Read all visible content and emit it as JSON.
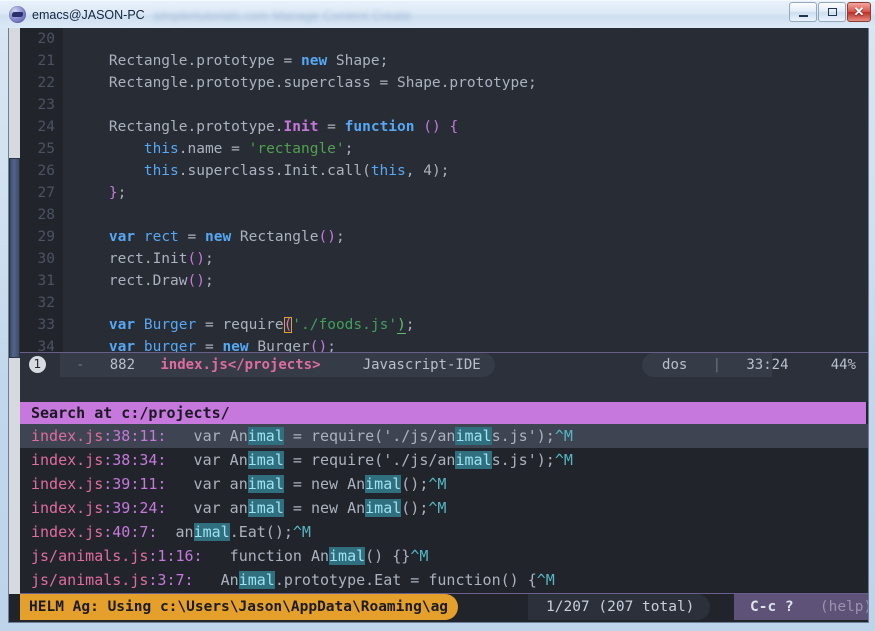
{
  "window": {
    "title": "emacs@JASON-PC",
    "ghost_title": "simplertutorials.com  Manage Content Create",
    "icon": "emacs-icon",
    "minimize_label": "–",
    "maximize_label": "□",
    "close_label": "✕"
  },
  "code": {
    "language": "Javascript",
    "lines": [
      {
        "n": "20",
        "segs": []
      },
      {
        "n": "21",
        "segs": [
          {
            "t": "    ",
            "c": "plain"
          },
          {
            "t": "Rectangle.prototype",
            "c": "plain"
          },
          {
            "t": " = ",
            "c": "plain"
          },
          {
            "t": "new",
            "c": "kw"
          },
          {
            "t": " Shape;",
            "c": "plain"
          }
        ]
      },
      {
        "n": "22",
        "segs": [
          {
            "t": "    ",
            "c": "plain"
          },
          {
            "t": "Rectangle.prototype.superclass",
            "c": "plain"
          },
          {
            "t": " = Shape.prototype;",
            "c": "plain"
          }
        ]
      },
      {
        "n": "23",
        "segs": []
      },
      {
        "n": "24",
        "segs": [
          {
            "t": "    ",
            "c": "plain"
          },
          {
            "t": "Rectangle.prototype.",
            "c": "plain"
          },
          {
            "t": "Init",
            "c": "fn"
          },
          {
            "t": " = ",
            "c": "plain"
          },
          {
            "t": "function",
            "c": "kw"
          },
          {
            "t": " ",
            "c": "plain"
          },
          {
            "t": "()",
            "c": "paren"
          },
          {
            "t": " ",
            "c": "plain"
          },
          {
            "t": "{",
            "c": "paren"
          }
        ]
      },
      {
        "n": "25",
        "segs": [
          {
            "t": "        ",
            "c": "plain"
          },
          {
            "t": "this",
            "c": "this"
          },
          {
            "t": ".name = ",
            "c": "plain"
          },
          {
            "t": "'rectangle'",
            "c": "str"
          },
          {
            "t": ";",
            "c": "plain"
          }
        ]
      },
      {
        "n": "26",
        "segs": [
          {
            "t": "        ",
            "c": "plain"
          },
          {
            "t": "this",
            "c": "this"
          },
          {
            "t": ".superclass.Init.call(",
            "c": "plain"
          },
          {
            "t": "this",
            "c": "this"
          },
          {
            "t": ", 4);",
            "c": "plain"
          }
        ]
      },
      {
        "n": "27",
        "segs": [
          {
            "t": "    ",
            "c": "plain"
          },
          {
            "t": "}",
            "c": "paren"
          },
          {
            "t": ";",
            "c": "plain"
          }
        ]
      },
      {
        "n": "28",
        "segs": []
      },
      {
        "n": "29",
        "segs": [
          {
            "t": "    ",
            "c": "plain"
          },
          {
            "t": "var",
            "c": "kw"
          },
          {
            "t": " ",
            "c": "plain"
          },
          {
            "t": "rect",
            "c": "var"
          },
          {
            "t": " = ",
            "c": "plain"
          },
          {
            "t": "new",
            "c": "kw"
          },
          {
            "t": " Rectangle",
            "c": "plain"
          },
          {
            "t": "()",
            "c": "paren"
          },
          {
            "t": ";",
            "c": "plain"
          }
        ]
      },
      {
        "n": "30",
        "segs": [
          {
            "t": "    ",
            "c": "plain"
          },
          {
            "t": "rect.Init",
            "c": "plain"
          },
          {
            "t": "()",
            "c": "paren"
          },
          {
            "t": ";",
            "c": "plain"
          }
        ]
      },
      {
        "n": "31",
        "segs": [
          {
            "t": "    ",
            "c": "plain"
          },
          {
            "t": "rect.Draw",
            "c": "plain"
          },
          {
            "t": "()",
            "c": "paren"
          },
          {
            "t": ";",
            "c": "plain"
          }
        ]
      },
      {
        "n": "32",
        "segs": []
      },
      {
        "n": "33",
        "segs": [
          {
            "t": "    ",
            "c": "plain"
          },
          {
            "t": "var",
            "c": "kw"
          },
          {
            "t": " ",
            "c": "plain"
          },
          {
            "t": "Burger",
            "c": "var"
          },
          {
            "t": " = require",
            "c": "plain"
          },
          {
            "t": "(",
            "c": "parenbox"
          },
          {
            "t": "'./foods.js'",
            "c": "strg"
          },
          {
            "t": ")",
            "c": "parenul"
          },
          {
            "t": ";",
            "c": "plain"
          }
        ]
      },
      {
        "n": "34",
        "segs": [
          {
            "t": "    ",
            "c": "plain"
          },
          {
            "t": "var",
            "c": "kw"
          },
          {
            "t": " ",
            "c": "plain"
          },
          {
            "t": "burger",
            "c": "var"
          },
          {
            "t": " = ",
            "c": "plain"
          },
          {
            "t": "new",
            "c": "kw"
          },
          {
            "t": " Burger",
            "c": "plain"
          },
          {
            "t": "()",
            "c": "paren"
          },
          {
            "t": ";",
            "c": "plain"
          }
        ]
      }
    ]
  },
  "modeline": {
    "window_number": "1",
    "modified": "-",
    "size": "882",
    "buffer": "index.js</projects>",
    "major_mode": "Javascript-IDE",
    "encoding": "dos",
    "separator": "|",
    "position": "33:24",
    "percent": "44%"
  },
  "helm": {
    "prompt": "->",
    "pattern": "imal",
    "source_header": "Search at c:/projects/",
    "candidates": [
      {
        "selected": true,
        "file": "index.js",
        "loc": ":38:11:",
        "pre": "   var An",
        "match1": "imal",
        "mid": " = require('./js/an",
        "match2": "imal",
        "post": "s.js');",
        "ctrl": "^M"
      },
      {
        "selected": false,
        "file": "index.js",
        "loc": ":38:34:",
        "pre": "   var An",
        "match1": "imal",
        "mid": " = require('./js/an",
        "match2": "imal",
        "post": "s.js');",
        "ctrl": "^M"
      },
      {
        "selected": false,
        "file": "index.js",
        "loc": ":39:11:",
        "pre": "   var an",
        "match1": "imal",
        "mid": " = new An",
        "match2": "imal",
        "post": "();",
        "ctrl": "^M"
      },
      {
        "selected": false,
        "file": "index.js",
        "loc": ":39:24:",
        "pre": "   var an",
        "match1": "imal",
        "mid": " = new An",
        "match2": "imal",
        "post": "();",
        "ctrl": "^M"
      },
      {
        "selected": false,
        "file": "index.js",
        "loc": ":40:7:",
        "pre": "  an",
        "match1": "imal",
        "mid": ".Eat();",
        "match2": "",
        "post": "",
        "ctrl": "^M"
      },
      {
        "selected": false,
        "file": "js/animals.js",
        "loc": ":1:16:",
        "pre": "   function An",
        "match1": "imal",
        "mid": "() {}",
        "match2": "",
        "post": "",
        "ctrl": "^M"
      },
      {
        "selected": false,
        "file": "js/animals.js",
        "loc": ":3:7:",
        "pre": "   An",
        "match1": "imal",
        "mid": ".prototype.Eat = function() {",
        "match2": "",
        "post": "",
        "ctrl": "^M"
      }
    ],
    "bottom_modeline": {
      "source": "HELM Ag: Using c:\\Users\\Jason\\AppData\\Roaming\\ag",
      "count": "1/207 (207 total)",
      "help_key": "C-c ?",
      "help_label": "(help)"
    }
  },
  "colors": {
    "code_bg": "#282c34",
    "gutter_bg": "#21252b",
    "modeline_bg": "#2b303b",
    "helm_source_bg": "#c678dd",
    "helm_selected_bg": "#3e4451",
    "helm_match_bg": "#2f6f7e",
    "helm_modeline_bg": "#e5a02b",
    "helm_help_bg": "#5e5278",
    "cursor": "#e5a02b"
  }
}
